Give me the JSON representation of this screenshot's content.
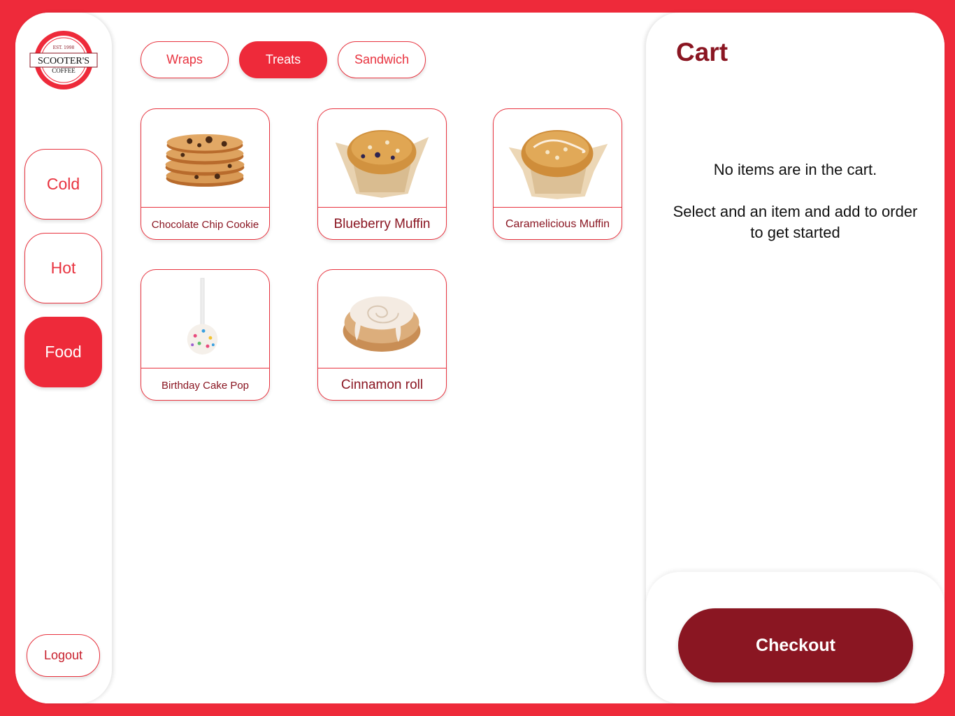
{
  "brand": {
    "logo_est": "EST. 1998",
    "logo_name": "SCOOTER'S",
    "logo_sub": "COFFEE"
  },
  "sidebar": {
    "items": [
      {
        "label": "Cold",
        "active": false
      },
      {
        "label": "Hot",
        "active": false
      },
      {
        "label": "Food",
        "active": true
      }
    ],
    "logout_label": "Logout"
  },
  "tabs": [
    {
      "label": "Wraps",
      "active": false
    },
    {
      "label": "Treats",
      "active": true
    },
    {
      "label": "Sandwich",
      "active": false
    }
  ],
  "products": [
    {
      "name": "Chocolate Chip Cookie",
      "icon": "cookie-image"
    },
    {
      "name": "Blueberry Muffin",
      "icon": "blueberry-muffin-image"
    },
    {
      "name": "Caramelicious Muffin",
      "icon": "caramel-muffin-image"
    },
    {
      "name": "Birthday Cake Pop",
      "icon": "cake-pop-image"
    },
    {
      "name": "Cinnamon roll",
      "icon": "cinnamon-roll-image"
    }
  ],
  "cart": {
    "title": "Cart",
    "empty_line1": "No items are in the cart.",
    "empty_line2": "Select and an item and add to order to get started",
    "checkout_label": "Checkout"
  },
  "colors": {
    "brand_red": "#ee2a3a",
    "dark_red": "#8a1622"
  }
}
